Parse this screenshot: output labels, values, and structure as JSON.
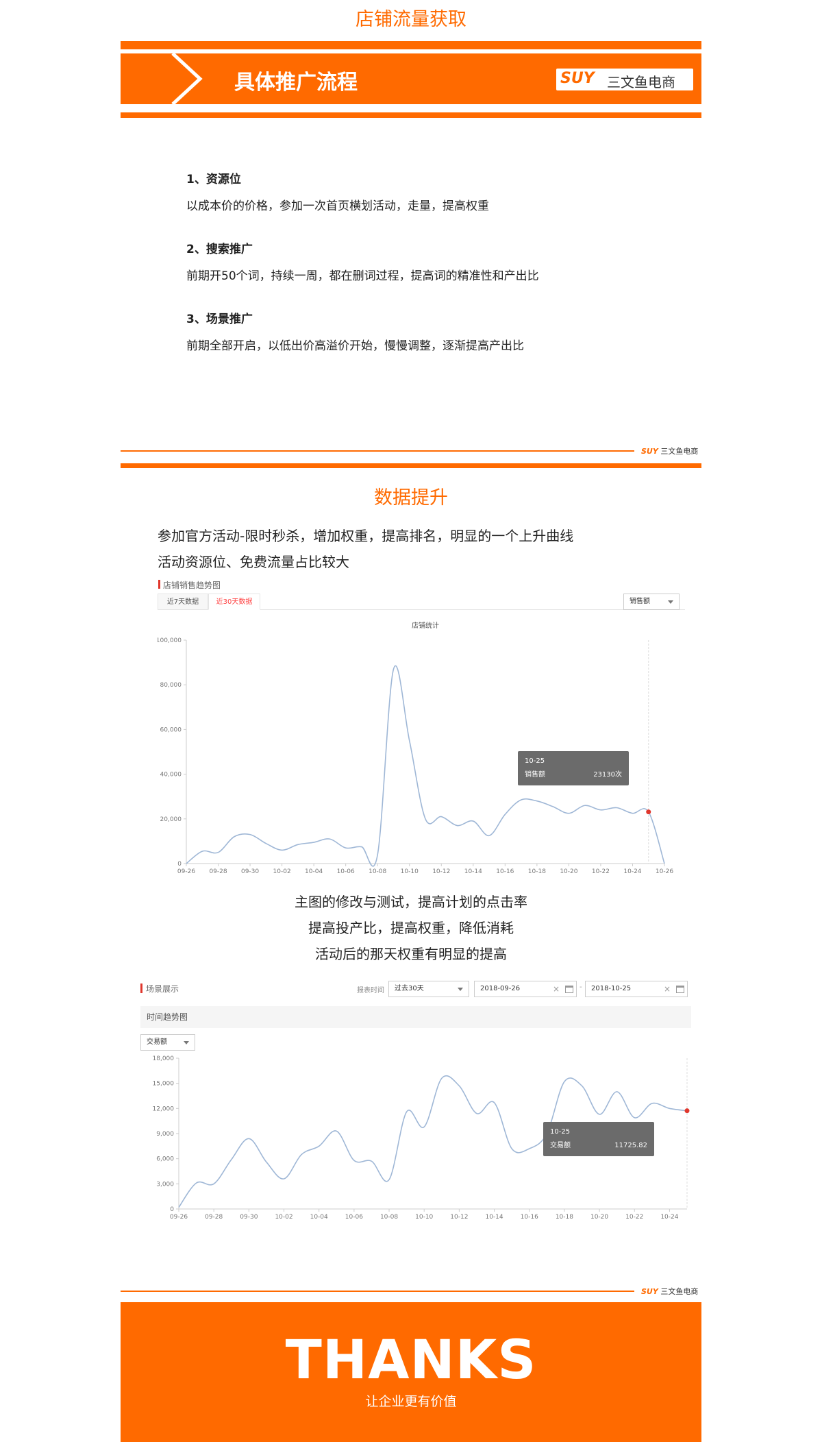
{
  "section1": {
    "title": "店铺流量获取",
    "banner_heading": "具体推广流程",
    "brand": {
      "logo": "SUY",
      "name": "三文鱼电商"
    },
    "items": [
      {
        "title": "1、资源位",
        "desc": "以成本价的价格，参加一次首页横划活动，走量，提高权重"
      },
      {
        "title": "2、搜索推广",
        "desc": "前期开50个词，持续一周，都在删词过程，提高词的精准性和产出比"
      },
      {
        "title": "3、场景推广",
        "desc": "前期全部开启，以低出价高溢价开始，慢慢调整，逐渐提高产出比"
      }
    ]
  },
  "divider_brand": {
    "logo": "SUY",
    "name": "三文鱼电商"
  },
  "section2": {
    "title": "数据提升",
    "lines": [
      "参加官方活动-限时秒杀，增加权重，提高排名，明显的一个上升曲线",
      "活动资源位、免费流量占比较大"
    ],
    "panel1": {
      "label": "店铺销售趋势图",
      "tabs": [
        {
          "label": "近7天数据",
          "active": false
        },
        {
          "label": "近30天数据",
          "active": true
        }
      ],
      "metric_select": "销售额"
    },
    "lines2": [
      "主图的修改与测试，提高计划的点击率",
      "提高投产比，提高权重，降低消耗",
      "活动后的那天权重有明显的提高"
    ],
    "panel2": {
      "label": "场景展示",
      "report_time_label": "报表时间",
      "period_select": "过去30天",
      "date_from": "2018-09-26",
      "date_to": "2018-10-25",
      "date_sep": "-",
      "subheader": "时间趋势图",
      "metric_select": "交易额"
    }
  },
  "thanks": {
    "title": "THANKS",
    "subtitle": "让企业更有价值"
  },
  "colors": {
    "accent": "#ff6a00",
    "line": "#9fb7d6",
    "marker": "#e0362c",
    "tooltip_bg": "#6b6b6b"
  },
  "icons": {
    "clear": "×",
    "calendar": "calendar-icon",
    "caret": "chevron-down-icon"
  },
  "chart_data": [
    {
      "type": "line",
      "title": "店铺统计",
      "x": [
        "09-26",
        "09-27",
        "09-28",
        "09-29",
        "09-30",
        "10-01",
        "10-02",
        "10-03",
        "10-04",
        "10-05",
        "10-06",
        "10-07",
        "10-08",
        "10-09",
        "10-10",
        "10-11",
        "10-12",
        "10-13",
        "10-14",
        "10-15",
        "10-16",
        "10-17",
        "10-18",
        "10-19",
        "10-20",
        "10-21",
        "10-22",
        "10-23",
        "10-24",
        "10-25",
        "10-26"
      ],
      "xticks": [
        "09-26",
        "09-28",
        "09-30",
        "10-02",
        "10-04",
        "10-06",
        "10-08",
        "10-10",
        "10-12",
        "10-14",
        "10-16",
        "10-18",
        "10-20",
        "10-22",
        "10-24",
        "10-26"
      ],
      "series": [
        {
          "values": [
            0,
            5500,
            5000,
            12000,
            13000,
            9000,
            6000,
            8500,
            9500,
            11000,
            7000,
            7500,
            4000,
            87000,
            55000,
            20000,
            21000,
            17000,
            19000,
            12500,
            22000,
            28500,
            28000,
            25500,
            22500,
            26000,
            24000,
            25000,
            22500,
            23130,
            0
          ]
        }
      ],
      "ylim": [
        0,
        100000
      ],
      "yticks": [
        "0",
        "20,000",
        "40,000",
        "60,000",
        "80,000",
        "100,000"
      ],
      "yvals": [
        0,
        20000,
        40000,
        60000,
        80000,
        100000
      ],
      "tooltip": {
        "x": "10-25",
        "label": "销售额",
        "value": "23130次",
        "index": 29
      },
      "grid": false
    },
    {
      "type": "line",
      "x": [
        "09-26",
        "09-27",
        "09-28",
        "09-29",
        "09-30",
        "10-01",
        "10-02",
        "10-03",
        "10-04",
        "10-05",
        "10-06",
        "10-07",
        "10-08",
        "10-09",
        "10-10",
        "10-11",
        "10-12",
        "10-13",
        "10-14",
        "10-15",
        "10-16",
        "10-17",
        "10-18",
        "10-19",
        "10-20",
        "10-21",
        "10-22",
        "10-23",
        "10-24",
        "10-25"
      ],
      "xticks": [
        "09-26",
        "09-28",
        "09-30",
        "10-02",
        "10-04",
        "10-06",
        "10-08",
        "10-10",
        "10-12",
        "10-14",
        "10-16",
        "10-18",
        "10-20",
        "10-22",
        "10-24"
      ],
      "series": [
        {
          "values": [
            200,
            3100,
            3000,
            5900,
            8400,
            5600,
            3600,
            6500,
            7500,
            9300,
            5800,
            5700,
            3500,
            11600,
            9800,
            15600,
            14700,
            11400,
            12700,
            7200,
            7200,
            9000,
            15200,
            14700,
            11300,
            14000,
            10900,
            12600,
            12000,
            11725.82
          ]
        }
      ],
      "ylim": [
        0,
        18000
      ],
      "yticks": [
        "0",
        "3,000",
        "6,000",
        "9,000",
        "12,000",
        "15,000",
        "18,000"
      ],
      "yvals": [
        0,
        3000,
        6000,
        9000,
        12000,
        15000,
        18000
      ],
      "tooltip": {
        "x": "10-25",
        "label": "交易额",
        "value": "11725.82",
        "index": 29
      },
      "grid": false
    }
  ]
}
